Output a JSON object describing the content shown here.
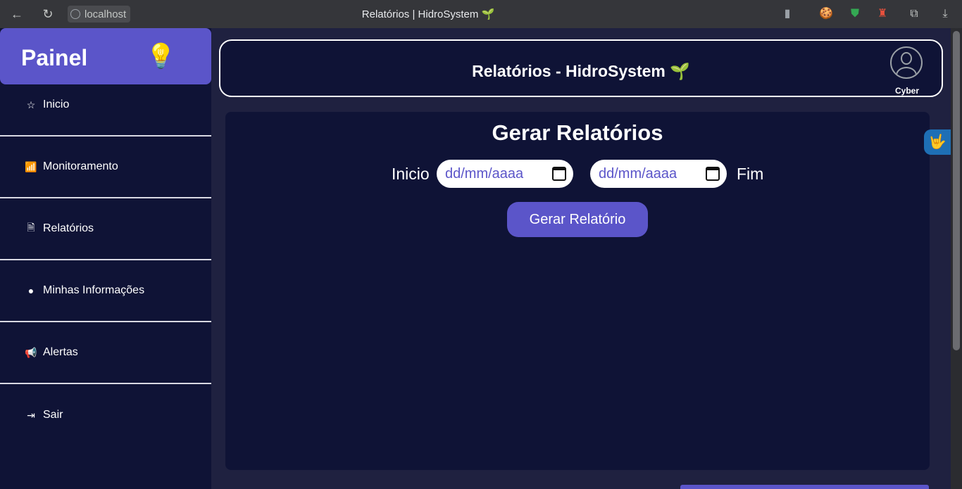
{
  "browser": {
    "url": "localhost",
    "tab_title": "Relatórios | HidroSystem 🌱",
    "back_icon": "←",
    "reload_icon": "↻"
  },
  "sidebar": {
    "brand": "Painel",
    "brand_icon": "💡",
    "items": [
      {
        "label": "Inicio",
        "icon": "☆"
      },
      {
        "label": "Monitoramento",
        "icon": "📶"
      },
      {
        "label": "Relatórios",
        "icon": "🗎"
      },
      {
        "label": "Minhas Informações",
        "icon": "●"
      },
      {
        "label": "Alertas",
        "icon": "📢"
      },
      {
        "label": "Sair",
        "icon": "⇥"
      }
    ]
  },
  "header": {
    "title": "Relatórios - HidroSystem 🌱",
    "user_name": "Cyber"
  },
  "main": {
    "title": "Gerar Relatórios",
    "start_label": "Inicio",
    "end_label": "Fim",
    "start_placeholder": "dd/mm/aaaa",
    "end_placeholder": "dd/mm/aaaa",
    "button_label": "Gerar Relatório"
  },
  "accessibility_widget_icon": "🤟"
}
